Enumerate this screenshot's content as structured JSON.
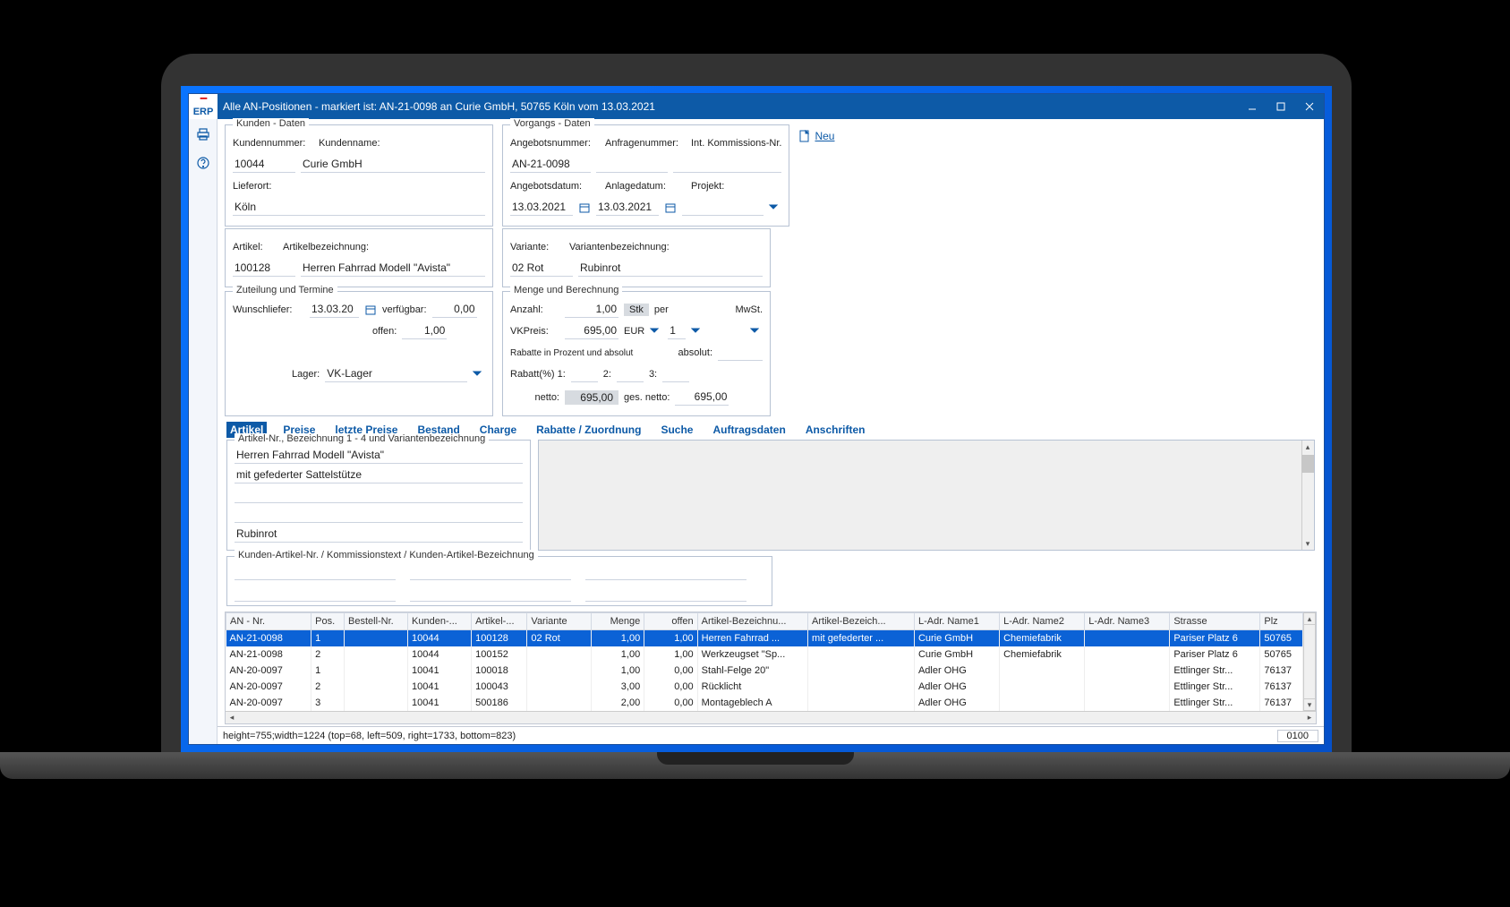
{
  "window": {
    "title": "Alle AN-Positionen - markiert ist: AN-21-0098 an Curie GmbH, 50765 Köln vom 13.03.2021",
    "logo_text": "ERP"
  },
  "neu_label": "Neu",
  "kunden": {
    "title": "Kunden - Daten",
    "kundennr_lbl": "Kundennummer:",
    "kundennr": "10044",
    "kundenname_lbl": "Kundenname:",
    "kundenname": "Curie GmbH",
    "lieferort_lbl": "Lieferort:",
    "lieferort": "Köln"
  },
  "vorgang": {
    "title": "Vorgangs - Daten",
    "angebotsnr_lbl": "Angebotsnummer:",
    "angebotsnr": "AN-21-0098",
    "anfragenr_lbl": "Anfragenummer:",
    "anfragenr": "",
    "kommnr_lbl": "Int. Kommissions-Nr.",
    "kommnr": "",
    "angebotsdat_lbl": "Angebotsdatum:",
    "angebotsdat": "13.03.2021",
    "anlagedat_lbl": "Anlagedatum:",
    "anlagedat": "13.03.2021",
    "projekt_lbl": "Projekt:",
    "projekt": ""
  },
  "artikel": {
    "artikel_lbl": "Artikel:",
    "artikel": "100128",
    "bez_lbl": "Artikelbezeichnung:",
    "bez": "Herren Fahrrad Modell \"Avista\"",
    "variante_lbl": "Variante:",
    "variante": "02 Rot",
    "varbez_lbl": "Variantenbezeichnung:",
    "varbez": "Rubinrot"
  },
  "zuteilung": {
    "title": "Zuteilung und Termine",
    "wunsch_lbl": "Wunschliefer:",
    "wunsch": "13.03.20",
    "verf_lbl": "verfügbar:",
    "verf": "0,00",
    "offen_lbl": "offen:",
    "offen": "1,00",
    "lager_lbl": "Lager:",
    "lager": "VK-Lager"
  },
  "menge": {
    "title": "Menge und Berechnung",
    "anzahl_lbl": "Anzahl:",
    "anzahl": "1,00",
    "stk": "Stk",
    "per_lbl": "per",
    "mwst_lbl": "MwSt.",
    "vkpreis_lbl": "VKPreis:",
    "vkpreis": "695,00",
    "eur": "EUR",
    "per_val": "1",
    "rabatte_title": "Rabatte in Prozent und absolut",
    "absolut_lbl": "absolut:",
    "rabatt1_lbl": "Rabatt(%) 1:",
    "rabatt2_lbl": "2:",
    "rabatt3_lbl": "3:",
    "netto_lbl": "netto:",
    "netto": "695,00",
    "gesnetto_lbl": "ges. netto:",
    "gesnetto": "695,00"
  },
  "tabs": [
    "Artikel",
    "Preise",
    "letzte Preise",
    "Bestand",
    "Charge",
    "Rabatte / Zuordnung",
    "Suche",
    "Auftragsdaten",
    "Anschriften"
  ],
  "active_tab": 0,
  "artikel_desc": {
    "title": "Artikel-Nr., Bezeichnung 1 - 4 und Variantenbezeichnung",
    "line1": "Herren Fahrrad Modell \"Avista\"",
    "line2": "mit gefederter Sattelstütze",
    "line3": "",
    "line4": "",
    "line5": "Rubinrot"
  },
  "kommission": {
    "title": "Kunden-Artikel-Nr. / Kommissionstext / Kunden-Artikel-Bezeichnung"
  },
  "grid": {
    "columns": [
      "AN - Nr.",
      "Pos.",
      "Bestell-Nr.",
      "Kunden-...",
      "Artikel-...",
      "Variante",
      "Menge",
      "offen",
      "Artikel-Bezeichnu...",
      "Artikel-Bezeich...",
      "L-Adr. Name1",
      "L-Adr. Name2",
      "L-Adr. Name3",
      "Strasse",
      "Plz"
    ],
    "rows": [
      {
        "sel": true,
        "c": [
          "AN-21-0098",
          "1",
          "",
          "10044",
          "100128",
          "02 Rot",
          "1,00",
          "1,00",
          "Herren Fahrrad ...",
          "mit gefederter ...",
          "Curie GmbH",
          "Chemiefabrik",
          "",
          "Pariser Platz 6",
          "50765"
        ]
      },
      {
        "sel": false,
        "c": [
          "AN-21-0098",
          "2",
          "",
          "10044",
          "100152",
          "",
          "1,00",
          "1,00",
          "Werkzeugset \"Sp...",
          "",
          "Curie GmbH",
          "Chemiefabrik",
          "",
          "Pariser Platz 6",
          "50765"
        ]
      },
      {
        "sel": false,
        "c": [
          "AN-20-0097",
          "1",
          "",
          "10041",
          "100018",
          "",
          "1,00",
          "0,00",
          "Stahl-Felge 20\"",
          "",
          "Adler OHG",
          "",
          "",
          "Ettlinger Str...",
          "76137"
        ]
      },
      {
        "sel": false,
        "c": [
          "AN-20-0097",
          "2",
          "",
          "10041",
          "100043",
          "",
          "3,00",
          "0,00",
          "Rücklicht",
          "",
          "Adler OHG",
          "",
          "",
          "Ettlinger Str...",
          "76137"
        ]
      },
      {
        "sel": false,
        "c": [
          "AN-20-0097",
          "3",
          "",
          "10041",
          "500186",
          "",
          "2,00",
          "0,00",
          "Montageblech A",
          "",
          "Adler OHG",
          "",
          "",
          "Ettlinger Str...",
          "76137"
        ]
      }
    ]
  },
  "status": {
    "left": "height=755;width=1224 (top=68, left=509, right=1733, bottom=823)",
    "right": "0100"
  }
}
